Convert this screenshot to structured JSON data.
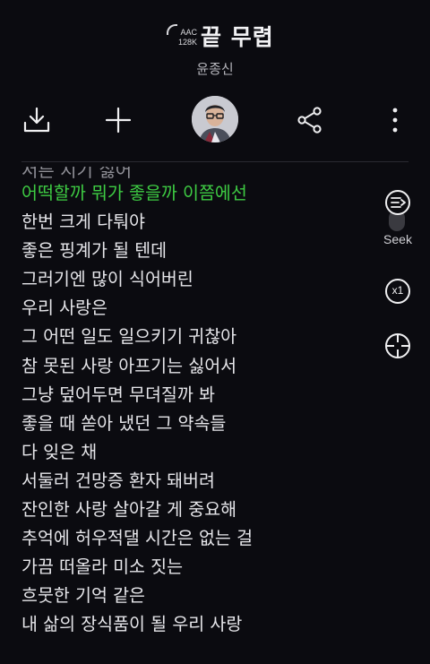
{
  "header": {
    "codec": "AAC",
    "bitrate": "128K",
    "song_title": "끝 무렵",
    "artist": "윤종신"
  },
  "toolbar": {
    "download_icon": "download-icon",
    "add_icon": "plus-icon",
    "share_icon": "share-icon",
    "more_icon": "more-vertical-icon"
  },
  "lyrics": {
    "partial_previous": "서른 지기 싫어",
    "active_line": "어떡할까 뭐가 좋을까 이쯤에선",
    "lines": [
      "한번 크게 다퉈야",
      "좋은 핑계가 될 텐데",
      "그러기엔 많이 식어버린",
      "우리 사랑은",
      "그 어떤 일도 일으키기 귀찮아",
      "참 못된 사랑 아프기는 싫어서",
      "그냥 덮어두면 무뎌질까 봐",
      "좋을 때 쏟아 냈던 그 약속들",
      "다 잊은 채",
      "서둘러 건망증 환자 돼버려",
      "잔인한 사랑 살아갈 게 중요해",
      "추억에 허우적댈 시간은 없는 걸",
      "가끔 떠올라 미소 짓는",
      "흐뭇한 기억 같은",
      "내 삶의 장식품이 될 우리 사랑"
    ]
  },
  "side_controls": {
    "seek_label": "Seek",
    "speed_label": "x1"
  },
  "colors": {
    "background": "#0b0b10",
    "active_lyric": "#3ecc43",
    "text": "#e6e6ea"
  }
}
